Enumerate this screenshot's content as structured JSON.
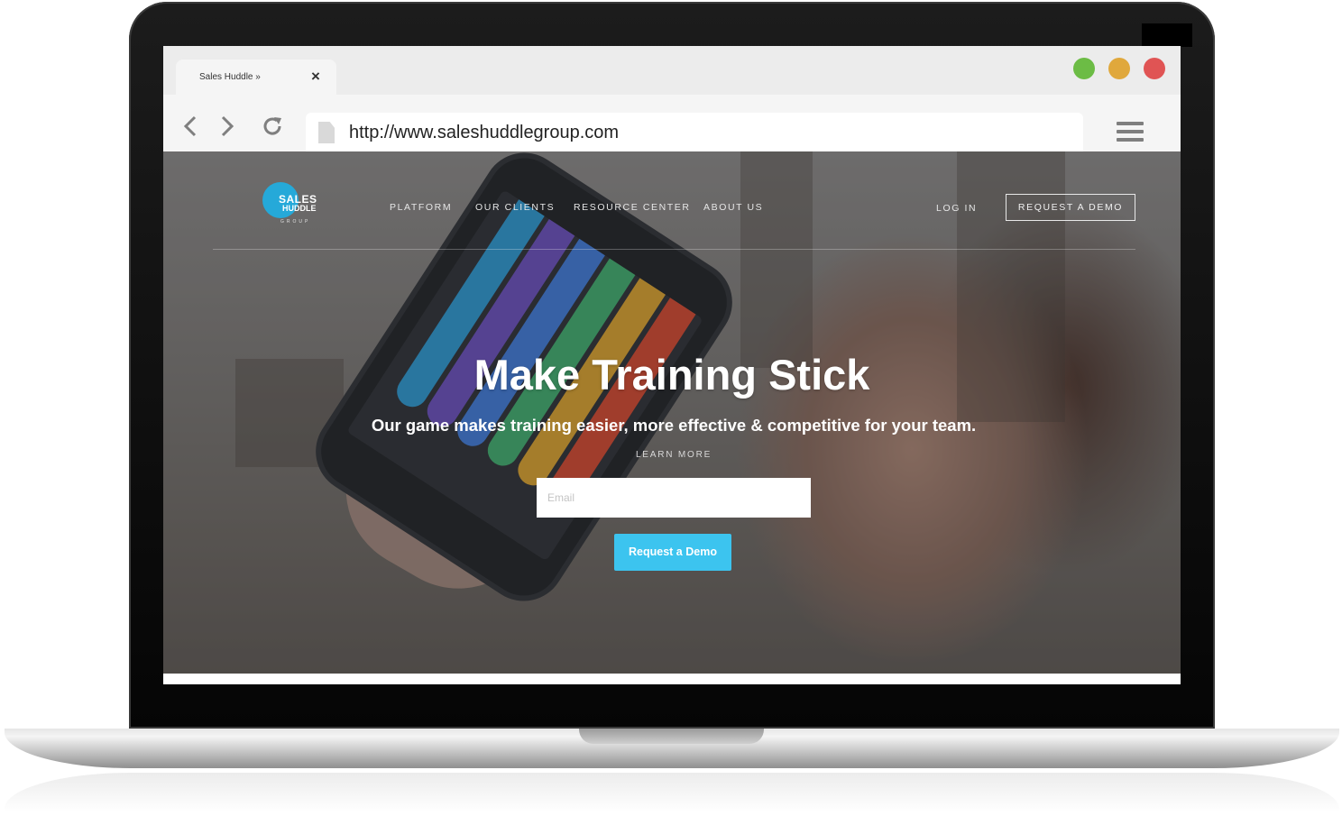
{
  "browser": {
    "tab_title": "Sales Huddle »",
    "tab_close": "×",
    "url": "http://www.saleshuddlegroup.com",
    "window_controls": [
      "green",
      "yellow",
      "red"
    ],
    "icons": {
      "back": "‹",
      "forward": "›",
      "reload": "⟳"
    }
  },
  "colors": {
    "accent": "#3cc4ef",
    "logo_blue": "#25a9d9",
    "dot_green": "#6cbc45",
    "dot_yellow": "#e0a83c",
    "dot_red": "#e05454"
  },
  "site": {
    "logo": {
      "line1": "SALES",
      "line2": "HUDDLE",
      "line3": "GROUP"
    },
    "nav": [
      "PLATFORM",
      "OUR CLIENTS",
      "RESOURCE CENTER",
      "ABOUT US"
    ],
    "login": "LOG IN",
    "request_demo_nav": "REQUEST A DEMO"
  },
  "hero": {
    "headline": "Make Training Stick",
    "subheadline": "Our game makes training easier, more effective & competitive for your team.",
    "learn_more": "LEARN MORE",
    "email_placeholder": "Email",
    "cta": "Request a Demo"
  }
}
